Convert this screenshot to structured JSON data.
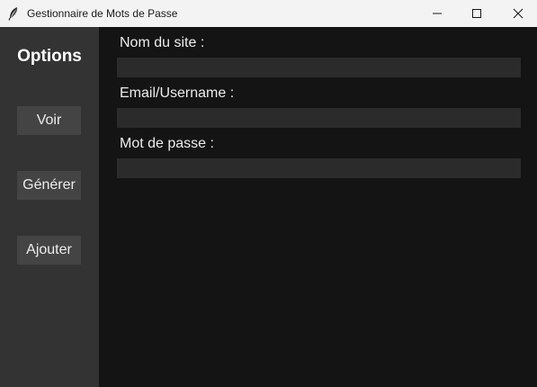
{
  "window": {
    "title": "Gestionnaire de Mots de Passe",
    "icon": "feather-icon",
    "controls": {
      "minimize_icon": "minimize-icon",
      "maximize_icon": "maximize-icon",
      "close_icon": "close-icon"
    }
  },
  "sidebar": {
    "title": "Options",
    "buttons": [
      {
        "label": "Voir"
      },
      {
        "label": "Générer"
      },
      {
        "label": "Ajouter"
      }
    ]
  },
  "form": {
    "site_label": "Nom du site :",
    "site_value": "",
    "email_label": "Email/Username :",
    "email_value": "",
    "password_label": "Mot de passe :",
    "password_value": ""
  },
  "colors": {
    "titlebar_bg": "#f3f3f3",
    "sidebar_bg": "#333333",
    "main_bg": "#141414",
    "button_bg": "#444444",
    "input_bg": "#2b2b2b",
    "text": "#ececec"
  }
}
